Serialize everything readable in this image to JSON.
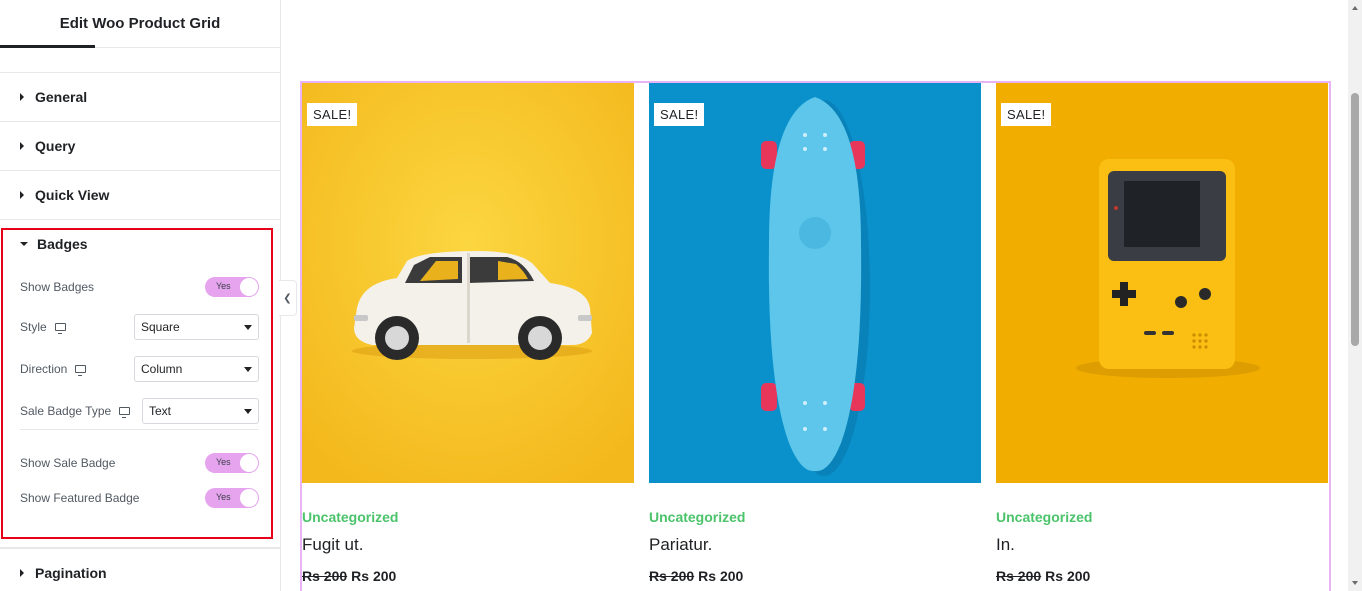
{
  "panel": {
    "title": "Edit Woo Product Grid",
    "sections": {
      "general": "General",
      "query": "Query",
      "quick_view": "Quick View",
      "badges": "Badges",
      "pagination": "Pagination"
    },
    "badges": {
      "show_badges": {
        "label": "Show Badges",
        "value": "Yes"
      },
      "style": {
        "label": "Style",
        "value": "Square",
        "icon": "monitor-icon"
      },
      "direction": {
        "label": "Direction",
        "value": "Column",
        "icon": "monitor-icon"
      },
      "sale_badge_type": {
        "label": "Sale Badge Type",
        "value": "Text",
        "icon": "monitor-icon"
      },
      "show_sale_badge": {
        "label": "Show Sale Badge",
        "value": "Yes"
      },
      "show_featured_badge": {
        "label": "Show Featured Badge",
        "value": "Yes"
      }
    },
    "highlight_color": "#e8001b",
    "toggle_color": "#e6a4ef"
  },
  "products": [
    {
      "badge": "SALE!",
      "category": "Uncategorized",
      "title": "Fugit ut.",
      "old_price": "Rs 200",
      "price": "Rs 200",
      "image": "white-car"
    },
    {
      "badge": "SALE!",
      "category": "Uncategorized",
      "title": "Pariatur.",
      "old_price": "Rs 200",
      "price": "Rs 200",
      "image": "blue-skateboard"
    },
    {
      "badge": "SALE!",
      "category": "Uncategorized",
      "title": "In.",
      "old_price": "Rs 200",
      "price": "Rs 200",
      "image": "yellow-gameboy"
    }
  ],
  "colors": {
    "category": "#4bc36b",
    "grid_outline": "#e9b3f5",
    "img1_bg": "#f7c325",
    "img2_bg": "#0a91cb",
    "img3_bg": "#f2ae00"
  }
}
